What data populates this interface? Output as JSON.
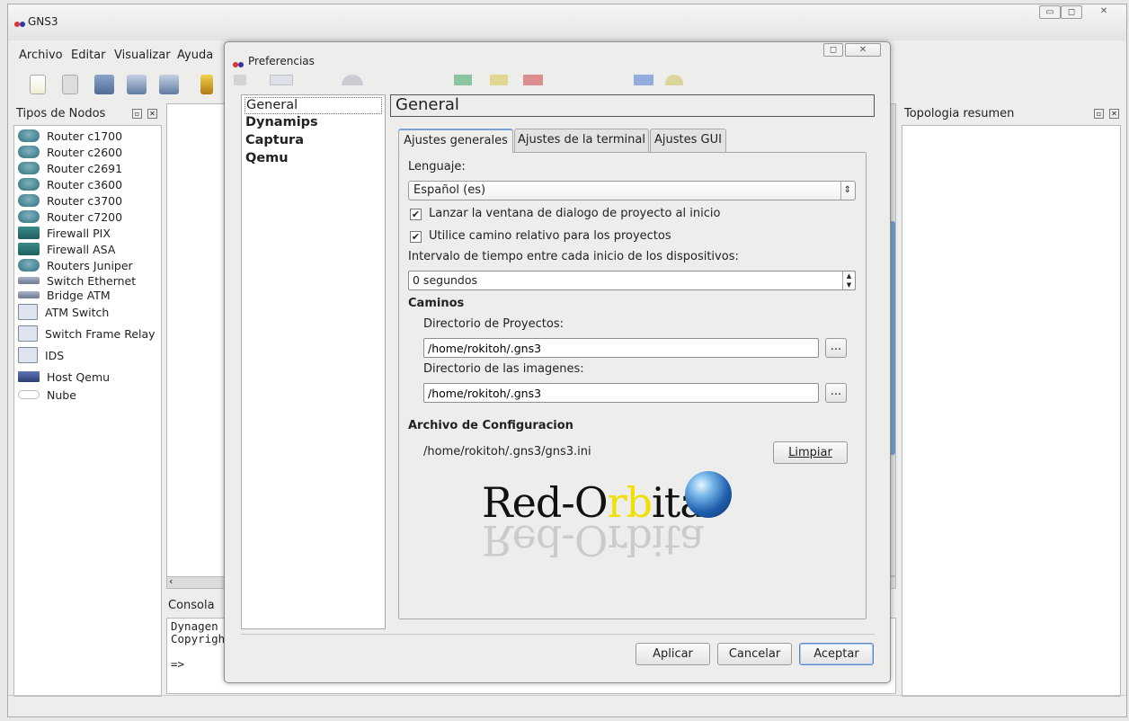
{
  "app": {
    "title": "GNS3"
  },
  "menu": [
    {
      "label": "Archivo"
    },
    {
      "label": "Editar"
    },
    {
      "label": "Visualizar"
    },
    {
      "label": "Ayuda"
    }
  ],
  "left_dock": {
    "title": "Tipos de Nodos",
    "nodes": [
      {
        "label": "Router c1700",
        "icon": "router-icon"
      },
      {
        "label": "Router c2600",
        "icon": "router-icon"
      },
      {
        "label": "Router c2691",
        "icon": "router-icon"
      },
      {
        "label": "Router c3600",
        "icon": "router-icon"
      },
      {
        "label": "Router c3700",
        "icon": "router-icon"
      },
      {
        "label": "Router c7200",
        "icon": "router-icon"
      },
      {
        "label": "Firewall PIX",
        "icon": "firewall-icon"
      },
      {
        "label": "Firewall ASA",
        "icon": "firewall-icon"
      },
      {
        "label": "Routers Juniper",
        "icon": "router-icon"
      },
      {
        "label": "Switch Ethernet",
        "icon": "ethernet-switch-icon"
      },
      {
        "label": "Bridge ATM",
        "icon": "atm-bridge-icon"
      },
      {
        "label": "ATM Switch",
        "icon": "atm-switch-icon"
      },
      {
        "label": "Switch Frame Relay",
        "icon": "frame-relay-switch-icon"
      },
      {
        "label": "IDS",
        "icon": "ids-icon"
      },
      {
        "label": "Host Qemu",
        "icon": "host-icon"
      },
      {
        "label": "Nube",
        "icon": "cloud-icon"
      }
    ]
  },
  "right_dock": {
    "title": "Topologia resumen"
  },
  "console": {
    "title": "Consola",
    "lines": [
      "Dynagen m",
      "Copyright (",
      "",
      "=>"
    ]
  },
  "dialog": {
    "title": "Preferencias",
    "nav": [
      {
        "label": "General",
        "selected": true
      },
      {
        "label": "Dynamips"
      },
      {
        "label": "Captura"
      },
      {
        "label": "Qemu"
      }
    ],
    "heading": "General",
    "tabs": [
      {
        "label": "Ajustes generales",
        "active": true
      },
      {
        "label": "Ajustes de la terminal"
      },
      {
        "label": "Ajustes GUI"
      }
    ],
    "form": {
      "language_label": "Lenguaje:",
      "language_value": "Español (es)",
      "check_launch_label": "Lanzar la ventana de dialogo de proyecto al inicio",
      "check_launch": true,
      "check_relative_label": "Utilice camino relativo para los proyectos",
      "check_relative": true,
      "interval_label": "Intervalo de tiempo entre cada inicio de los dispositivos:",
      "interval_value": "0 segundos",
      "paths_heading": "Caminos",
      "projects_dir_label": "Directorio de Proyectos:",
      "projects_dir_value": "/home/rokitoh/.gns3",
      "images_dir_label": "Directorio de las imagenes:",
      "images_dir_value": "/home/rokitoh/.gns3",
      "browse_label": "...",
      "config_heading": "Archivo de Configuracion",
      "config_path": "/home/rokitoh/.gns3/gns3.ini",
      "clear_label": "Limpiar"
    },
    "logo": {
      "text": "Red-Orbita",
      "colors": {
        "accent": "#f0e000"
      }
    },
    "buttons": {
      "apply": "Aplicar",
      "cancel": "Cancelar",
      "accept": "Aceptar"
    }
  }
}
